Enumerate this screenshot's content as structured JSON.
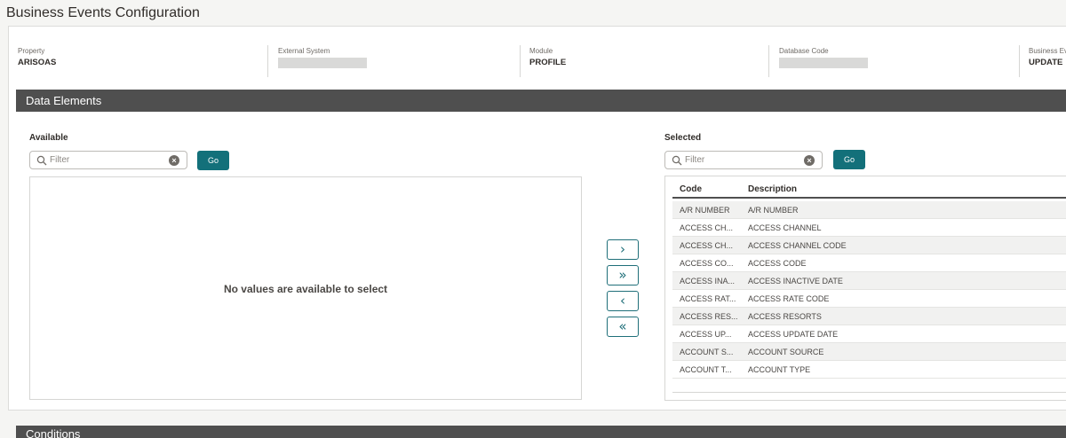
{
  "page": {
    "title": "Business Events Configuration"
  },
  "info": [
    {
      "label": "Property",
      "value": "ARISOAS"
    },
    {
      "label": "External System",
      "value": ""
    },
    {
      "label": "Module",
      "value": "PROFILE"
    },
    {
      "label": "Database Code",
      "value": ""
    },
    {
      "label": "Business Ev",
      "value": "UPDATE"
    }
  ],
  "data_elements": {
    "title": "Data Elements",
    "available": {
      "label": "Available",
      "filter_placeholder": "Filter",
      "go_label": "Go",
      "empty_message": "No values are available to select"
    },
    "move_buttons": {
      "move_one": "›",
      "move_all": "»",
      "remove_one": "‹",
      "remove_all": "«"
    },
    "selected": {
      "label": "Selected",
      "filter_placeholder": "Filter",
      "go_label": "Go",
      "columns": [
        "Code",
        "Description"
      ],
      "rows": [
        [
          "A/R NUMBER",
          "A/R NUMBER"
        ],
        [
          "ACCESS CH...",
          "ACCESS CHANNEL"
        ],
        [
          "ACCESS CH...",
          "ACCESS CHANNEL CODE"
        ],
        [
          "ACCESS CO...",
          "ACCESS CODE"
        ],
        [
          "ACCESS INA...",
          "ACCESS INACTIVE DATE"
        ],
        [
          "ACCESS RAT...",
          "ACCESS RATE CODE"
        ],
        [
          "ACCESS RES...",
          "ACCESS RESORTS"
        ],
        [
          "ACCESS UP...",
          "ACCESS UPDATE DATE"
        ],
        [
          "ACCOUNT S...",
          "ACCOUNT SOURCE"
        ],
        [
          "ACCOUNT T...",
          "ACCOUNT TYPE"
        ]
      ]
    }
  },
  "conditions": {
    "title": "Conditions"
  },
  "colors": {
    "accent": "#13707a",
    "section_bar": "#4f4f4f"
  },
  "icons": {
    "filter_search": "search-icon",
    "filter_clear": "clear-icon"
  }
}
